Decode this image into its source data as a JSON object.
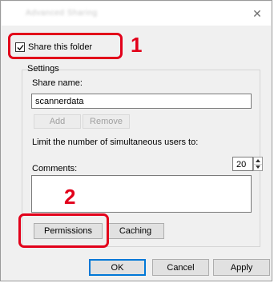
{
  "dialog": {
    "title": "Advanced Sharing",
    "share_checkbox": {
      "label": "Share this folder",
      "checked": true
    },
    "settings": {
      "group_label": "Settings",
      "share_name": {
        "label": "Share name:",
        "value": "scannerdata"
      },
      "add_label": "Add",
      "remove_label": "Remove",
      "limit": {
        "label": "Limit the number of simultaneous users to:",
        "value": "20"
      },
      "comments": {
        "label": "Comments:",
        "value": ""
      },
      "permissions_label": "Permissions",
      "caching_label": "Caching"
    },
    "buttons": {
      "ok": "OK",
      "cancel": "Cancel",
      "apply": "Apply"
    }
  },
  "annotations": [
    {
      "number": "1",
      "color": "#e2001a"
    },
    {
      "number": "2",
      "color": "#e2001a"
    }
  ]
}
